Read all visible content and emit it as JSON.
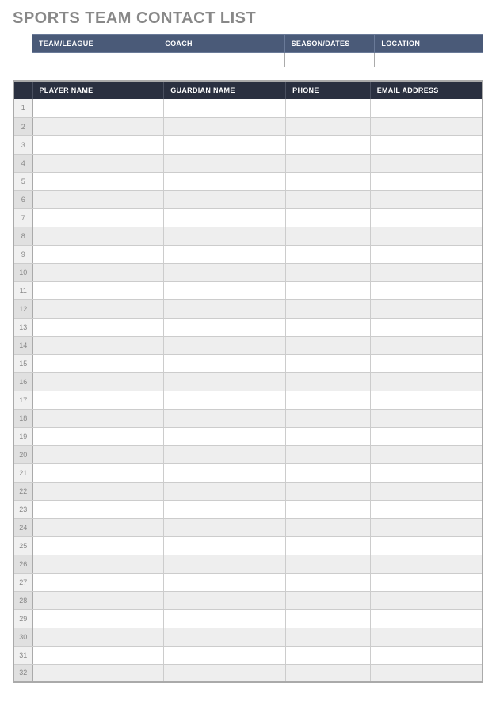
{
  "title": "SPORTS TEAM CONTACT LIST",
  "info_headers": {
    "team_league": "TEAM/LEAGUE",
    "coach": "COACH",
    "season_dates": "SEASON/DATES",
    "location": "LOCATION"
  },
  "info_values": {
    "team_league": "",
    "coach": "",
    "season_dates": "",
    "location": ""
  },
  "contact_headers": {
    "player_name": "PLAYER NAME",
    "guardian_name": "GUARDIAN NAME",
    "phone": "PHONE",
    "email": "EMAIL ADDRESS"
  },
  "rows": [
    {
      "num": "1",
      "player_name": "",
      "guardian_name": "",
      "phone": "",
      "email": ""
    },
    {
      "num": "2",
      "player_name": "",
      "guardian_name": "",
      "phone": "",
      "email": ""
    },
    {
      "num": "3",
      "player_name": "",
      "guardian_name": "",
      "phone": "",
      "email": ""
    },
    {
      "num": "4",
      "player_name": "",
      "guardian_name": "",
      "phone": "",
      "email": ""
    },
    {
      "num": "5",
      "player_name": "",
      "guardian_name": "",
      "phone": "",
      "email": ""
    },
    {
      "num": "6",
      "player_name": "",
      "guardian_name": "",
      "phone": "",
      "email": ""
    },
    {
      "num": "7",
      "player_name": "",
      "guardian_name": "",
      "phone": "",
      "email": ""
    },
    {
      "num": "8",
      "player_name": "",
      "guardian_name": "",
      "phone": "",
      "email": ""
    },
    {
      "num": "9",
      "player_name": "",
      "guardian_name": "",
      "phone": "",
      "email": ""
    },
    {
      "num": "10",
      "player_name": "",
      "guardian_name": "",
      "phone": "",
      "email": ""
    },
    {
      "num": "11",
      "player_name": "",
      "guardian_name": "",
      "phone": "",
      "email": ""
    },
    {
      "num": "12",
      "player_name": "",
      "guardian_name": "",
      "phone": "",
      "email": ""
    },
    {
      "num": "13",
      "player_name": "",
      "guardian_name": "",
      "phone": "",
      "email": ""
    },
    {
      "num": "14",
      "player_name": "",
      "guardian_name": "",
      "phone": "",
      "email": ""
    },
    {
      "num": "15",
      "player_name": "",
      "guardian_name": "",
      "phone": "",
      "email": ""
    },
    {
      "num": "16",
      "player_name": "",
      "guardian_name": "",
      "phone": "",
      "email": ""
    },
    {
      "num": "17",
      "player_name": "",
      "guardian_name": "",
      "phone": "",
      "email": ""
    },
    {
      "num": "18",
      "player_name": "",
      "guardian_name": "",
      "phone": "",
      "email": ""
    },
    {
      "num": "19",
      "player_name": "",
      "guardian_name": "",
      "phone": "",
      "email": ""
    },
    {
      "num": "20",
      "player_name": "",
      "guardian_name": "",
      "phone": "",
      "email": ""
    },
    {
      "num": "21",
      "player_name": "",
      "guardian_name": "",
      "phone": "",
      "email": ""
    },
    {
      "num": "22",
      "player_name": "",
      "guardian_name": "",
      "phone": "",
      "email": ""
    },
    {
      "num": "23",
      "player_name": "",
      "guardian_name": "",
      "phone": "",
      "email": ""
    },
    {
      "num": "24",
      "player_name": "",
      "guardian_name": "",
      "phone": "",
      "email": ""
    },
    {
      "num": "25",
      "player_name": "",
      "guardian_name": "",
      "phone": "",
      "email": ""
    },
    {
      "num": "26",
      "player_name": "",
      "guardian_name": "",
      "phone": "",
      "email": ""
    },
    {
      "num": "27",
      "player_name": "",
      "guardian_name": "",
      "phone": "",
      "email": ""
    },
    {
      "num": "28",
      "player_name": "",
      "guardian_name": "",
      "phone": "",
      "email": ""
    },
    {
      "num": "29",
      "player_name": "",
      "guardian_name": "",
      "phone": "",
      "email": ""
    },
    {
      "num": "30",
      "player_name": "",
      "guardian_name": "",
      "phone": "",
      "email": ""
    },
    {
      "num": "31",
      "player_name": "",
      "guardian_name": "",
      "phone": "",
      "email": ""
    },
    {
      "num": "32",
      "player_name": "",
      "guardian_name": "",
      "phone": "",
      "email": ""
    }
  ]
}
